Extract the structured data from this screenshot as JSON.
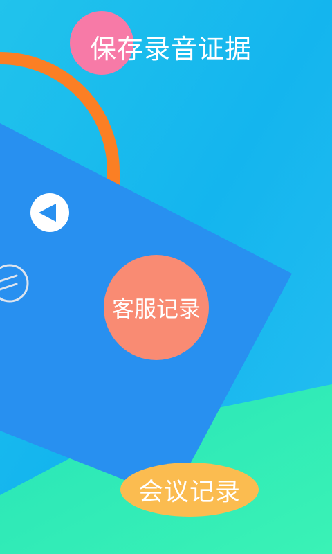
{
  "screen": {
    "title": "保存录音证据",
    "feature_bubbles": [
      {
        "label": "客服记录"
      },
      {
        "label": "会议记录"
      }
    ],
    "icons": {
      "play": "play-icon",
      "menu": "menu-icon"
    }
  },
  "colors": {
    "sky_blue": "#22b6ef",
    "panel_blue": "#2890f0",
    "mint": "#30f0b8",
    "orange_arc": "#fb7f24",
    "pink": "#f77aa7",
    "salmon": "#f98b73",
    "amber": "#fbbc50"
  }
}
